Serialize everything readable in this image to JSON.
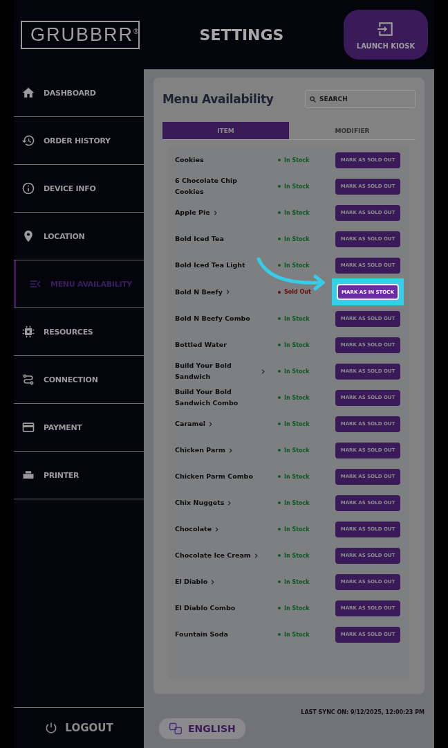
{
  "header": {
    "logo": "GRUBBRR",
    "logo_mark": "®",
    "title": "SETTINGS",
    "launch_button": "LAUNCH KIOSK"
  },
  "sidebar": {
    "items": [
      {
        "label": "DASHBOARD",
        "selected": false
      },
      {
        "label": "ORDER HISTORY",
        "selected": false
      },
      {
        "label": "DEVICE INFO",
        "selected": false
      },
      {
        "label": "LOCATION",
        "selected": false
      },
      {
        "label": "MENU AVAILABILITY",
        "selected": true
      },
      {
        "label": "RESOURCES",
        "selected": false
      },
      {
        "label": "CONNECTION",
        "selected": false
      },
      {
        "label": "PAYMENT",
        "selected": false
      },
      {
        "label": "PRINTER",
        "selected": false
      }
    ],
    "logout": "LOGOUT"
  },
  "panel": {
    "title": "Menu Availability",
    "search": {
      "placeholder": "SEARCH"
    },
    "tabs": [
      {
        "label": "ITEM",
        "selected": true
      },
      {
        "label": "MODIFIER",
        "selected": false
      }
    ],
    "rows": [
      {
        "name": "Cookies",
        "chevron": false,
        "status": "In Stock",
        "sold_out": false,
        "button": "MARK AS SOLD OUT",
        "highlighted": false
      },
      {
        "name": "6 Chocolate Chip Cookies",
        "chevron": false,
        "status": "In Stock",
        "sold_out": false,
        "button": "MARK AS SOLD OUT",
        "highlighted": false
      },
      {
        "name": "Apple Pie",
        "chevron": true,
        "status": "In Stock",
        "sold_out": false,
        "button": "MARK AS SOLD OUT",
        "highlighted": false
      },
      {
        "name": "Bold Iced Tea",
        "chevron": false,
        "status": "In Stock",
        "sold_out": false,
        "button": "MARK AS SOLD OUT",
        "highlighted": false
      },
      {
        "name": "Bold Iced Tea Light",
        "chevron": false,
        "status": "In Stock",
        "sold_out": false,
        "button": "MARK AS SOLD OUT",
        "highlighted": false
      },
      {
        "name": "Bold N Beefy",
        "chevron": true,
        "status": "Sold Out",
        "sold_out": true,
        "button": "MARK AS IN STOCK",
        "highlighted": true
      },
      {
        "name": "Bold N Beefy Combo",
        "chevron": false,
        "status": "In Stock",
        "sold_out": false,
        "button": "MARK AS SOLD OUT",
        "highlighted": false
      },
      {
        "name": "Bottled Water",
        "chevron": false,
        "status": "In Stock",
        "sold_out": false,
        "button": "MARK AS SOLD OUT",
        "highlighted": false
      },
      {
        "name": "Build Your Bold Sandwich",
        "chevron": true,
        "status": "In Stock",
        "sold_out": false,
        "button": "MARK AS SOLD OUT",
        "highlighted": false
      },
      {
        "name": "Build Your Bold Sandwich Combo",
        "chevron": false,
        "status": "In Stock",
        "sold_out": false,
        "button": "MARK AS SOLD OUT",
        "highlighted": false
      },
      {
        "name": "Caramel",
        "chevron": true,
        "status": "In Stock",
        "sold_out": false,
        "button": "MARK AS SOLD OUT",
        "highlighted": false
      },
      {
        "name": "Chicken Parm",
        "chevron": true,
        "status": "In Stock",
        "sold_out": false,
        "button": "MARK AS SOLD OUT",
        "highlighted": false
      },
      {
        "name": "Chicken Parm Combo",
        "chevron": false,
        "status": "In Stock",
        "sold_out": false,
        "button": "MARK AS SOLD OUT",
        "highlighted": false
      },
      {
        "name": "Chix Nuggets",
        "chevron": true,
        "status": "In Stock",
        "sold_out": false,
        "button": "MARK AS SOLD OUT",
        "highlighted": false
      },
      {
        "name": "Chocolate",
        "chevron": true,
        "status": "In Stock",
        "sold_out": false,
        "button": "MARK AS SOLD OUT",
        "highlighted": false
      },
      {
        "name": "Chocolate Ice Cream",
        "chevron": true,
        "status": "In Stock",
        "sold_out": false,
        "button": "MARK AS SOLD OUT",
        "highlighted": false
      },
      {
        "name": "El Diablo",
        "chevron": true,
        "status": "In Stock",
        "sold_out": false,
        "button": "MARK AS SOLD OUT",
        "highlighted": false
      },
      {
        "name": "El Diablo Combo",
        "chevron": false,
        "status": "In Stock",
        "sold_out": false,
        "button": "MARK AS SOLD OUT",
        "highlighted": false
      },
      {
        "name": "Fountain Soda",
        "chevron": false,
        "status": "In Stock",
        "sold_out": false,
        "button": "MARK AS SOLD OUT",
        "highlighted": false
      }
    ]
  },
  "footer": {
    "last_sync": "LAST SYNC ON: 9/12/2025, 12:00:23 PM",
    "language": "ENGLISH"
  }
}
